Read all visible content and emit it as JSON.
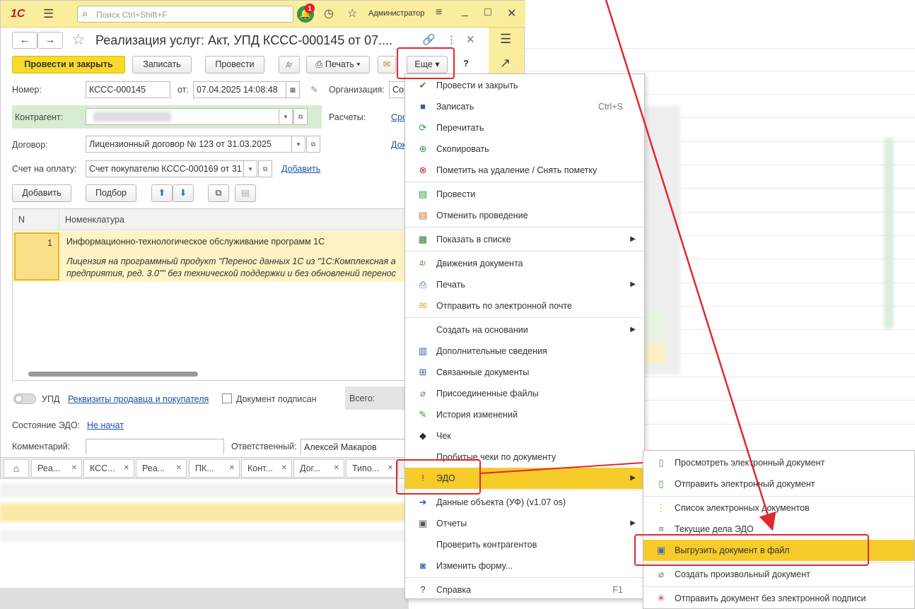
{
  "window": {
    "search_placeholder": "Поиск Ctrl+Shift+F",
    "user_name": "Администратор",
    "notification_count": "1"
  },
  "document": {
    "title": "Реализация услуг: Акт, УПД КССС-000145 от 07....",
    "toolbar": {
      "post_close": "Провести и закрыть",
      "save": "Записать",
      "post": "Провести",
      "print": "Печать",
      "more": "Еще",
      "help": "?"
    },
    "fields": {
      "number_label": "Номер:",
      "number_value": "КССС-000145",
      "date_label": "от:",
      "date_value": "07.04.2025 14:08:48",
      "org_label": "Организация:",
      "org_value": "Сор",
      "counterparty_label": "Контрагент:",
      "settlements_label": "Расчеты:",
      "settlements_link": "Сро",
      "contract_label": "Договор:",
      "contract_value": "Лицензионный договор № 123 от 31.03.2025",
      "contract_link": "Док",
      "invoice_label": "Счет на оплату:",
      "invoice_value": "Счет покупателю КССС-000169 от 31",
      "invoice_add": "Добавить"
    },
    "table_toolbar": {
      "add": "Добавить",
      "select": "Подбор"
    },
    "table": {
      "col_n": "N",
      "col_item": "Номенклатура",
      "rows": [
        {
          "n": "1",
          "item": "Информационно-технологическое обслуживание программ 1С",
          "desc_line1": "Лицензия на программный продукт \"Перенос данных 1С из \"1С:Комплексная а",
          "desc_line2": "предприятия, ред. 3.0\"\" без технической поддержки и без обновлений перенос"
        }
      ]
    },
    "footer": {
      "upd_label": "УПД",
      "requisites_link": "Реквизиты продавца и покупателя",
      "signed_label": "Документ подписан",
      "total_label": "Всего:",
      "edo_state_label": "Состояние ЭДО:",
      "edo_state_value": "Не начат",
      "comment_label": "Комментарий:",
      "responsible_label": "Ответственный:",
      "responsible_value": "Алексей Макаров"
    }
  },
  "tabs": [
    "Реа...",
    "КСС...",
    "Реа...",
    "ПК...",
    "Конт...",
    "Дог...",
    "Типо..."
  ],
  "menu": {
    "items": [
      {
        "label": "Провести и закрыть",
        "icon": "post-close-icon",
        "glyph": "✔"
      },
      {
        "label": "Записать",
        "icon": "save-icon",
        "glyph": "■",
        "shortcut": "Ctrl+S"
      },
      {
        "label": "Перечитать",
        "icon": "reload-icon",
        "glyph": "⟳"
      },
      {
        "label": "Скопировать",
        "icon": "copy-icon",
        "glyph": "⊕"
      },
      {
        "label": "Пометить на удаление / Снять пометку",
        "icon": "delete-mark-icon",
        "glyph": "⊗"
      },
      {
        "label": "Провести",
        "icon": "post-icon",
        "glyph": "▤"
      },
      {
        "label": "Отменить проведение",
        "icon": "unpost-icon",
        "glyph": "▤"
      },
      {
        "label": "Показать в списке",
        "icon": "show-in-list-icon",
        "glyph": "▦",
        "submenu": true
      },
      {
        "label": "Движения документа",
        "icon": "movements-icon",
        "glyph": "Дт"
      },
      {
        "label": "Печать",
        "icon": "print-icon",
        "glyph": "⎙",
        "submenu": true
      },
      {
        "label": "Отправить по электронной почте",
        "icon": "email-icon",
        "glyph": "✉"
      },
      {
        "label": "Создать на основании",
        "icon": "",
        "glyph": "",
        "submenu": true
      },
      {
        "label": "Дополнительные сведения",
        "icon": "info-icon",
        "glyph": "▥"
      },
      {
        "label": "Связанные документы",
        "icon": "related-docs-icon",
        "glyph": "⊞"
      },
      {
        "label": "Присоединенные файлы",
        "icon": "attachment-icon",
        "glyph": "⌀"
      },
      {
        "label": "История изменений",
        "icon": "history-icon",
        "glyph": "✎"
      },
      {
        "label": "Чек",
        "icon": "receipt-icon",
        "glyph": "◆"
      },
      {
        "label": "Пробитые чеки по документу",
        "icon": "",
        "glyph": ""
      },
      {
        "label": "ЭДО",
        "icon": "edo-icon",
        "glyph": "!",
        "submenu": true
      },
      {
        "label": "Данные объекта (УФ) (v1.07 os)",
        "icon": "object-data-icon",
        "glyph": "➜"
      },
      {
        "label": "Отчеты",
        "icon": "reports-icon",
        "glyph": "▣",
        "submenu": true
      },
      {
        "label": "Проверить контрагентов",
        "icon": "",
        "glyph": ""
      },
      {
        "label": "Изменить форму...",
        "icon": "change-form-icon",
        "glyph": "◙"
      },
      {
        "label": "Справка",
        "icon": "help-icon",
        "glyph": "?",
        "shortcut": "F1"
      }
    ]
  },
  "submenu": {
    "items": [
      {
        "label": "Просмотреть электронный документ",
        "icon": "view-doc-icon",
        "glyph": "▯"
      },
      {
        "label": "Отправить электронный документ",
        "icon": "send-doc-icon",
        "glyph": "▯"
      },
      {
        "label": "Список электронных документов",
        "icon": "doc-list-icon",
        "glyph": "⋮"
      },
      {
        "label": "Текущие дела ЭДО",
        "icon": "current-tasks-icon",
        "glyph": "≡"
      },
      {
        "label": "Выгрузить документ в файл",
        "icon": "export-file-icon",
        "glyph": "▣"
      },
      {
        "label": "Создать произвольный документ",
        "icon": "create-doc-icon",
        "glyph": "⌀"
      },
      {
        "label": "Отправить документ без электронной подписи",
        "icon": "send-unsigned-icon",
        "glyph": "✳"
      }
    ]
  },
  "colors": {
    "accent_yellow": "#f7cb2a",
    "highlight_red": "#e0292e",
    "link_blue": "#1b52a8"
  }
}
